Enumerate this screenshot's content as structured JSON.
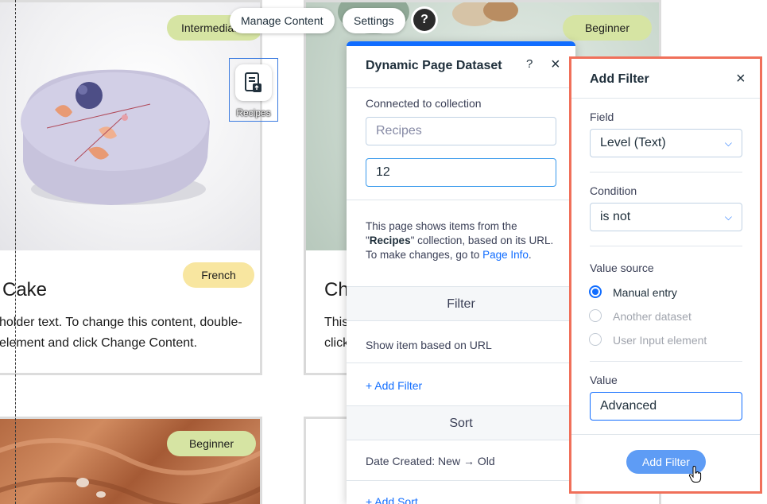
{
  "toolbar": {
    "manage_content": "Manage Content",
    "settings": "Settings",
    "help": "?"
  },
  "dataset_element": {
    "label": "Recipes",
    "icon": "dataset-icon"
  },
  "background_cards": {
    "card1": {
      "badge_top": "Intermediate",
      "badge_bottom": "French",
      "title_fragment": "Cake",
      "body_line1": "holder text. To change this content, double-",
      "body_line2": "element and click Change Content."
    },
    "card2": {
      "badge_top": "Beginner",
      "title_fragment": "Ch",
      "body_line1": "This",
      "body_line2": "click"
    },
    "card3": {
      "badge_top": "Beginner"
    }
  },
  "dataset_panel": {
    "title": "Dynamic Page Dataset",
    "help_icon": "?",
    "close_icon": "×",
    "connected_label": "Connected to collection",
    "collection_placeholder": "Recipes",
    "items_value": "12",
    "description_pre": "This page shows items from the \"",
    "description_collection": "Recipes",
    "description_mid": "\" collection, based on its URL. To make changes, go to ",
    "description_link": "Page Info",
    "description_end": ".",
    "filter_heading": "Filter",
    "filter_item": "Show item based on URL",
    "add_filter_link": "+ Add Filter",
    "sort_heading": "Sort",
    "sort_item": "Date Created: New → Old",
    "add_sort_link": "+ Add Sort"
  },
  "add_filter_panel": {
    "title": "Add Filter",
    "close_icon": "×",
    "field_label": "Field",
    "field_value": "Level (Text)",
    "condition_label": "Condition",
    "condition_value": "is not",
    "value_source_label": "Value source",
    "value_source_options": [
      {
        "label": "Manual entry",
        "selected": true
      },
      {
        "label": "Another dataset",
        "selected": false
      },
      {
        "label": "User Input element",
        "selected": false
      }
    ],
    "value_label": "Value",
    "value_input": "Advanced",
    "submit_label": "Add Filter"
  },
  "colors": {
    "accent": "#116dff",
    "highlight_frame": "#f0705a",
    "badge_green": "#d6e4a3",
    "badge_yellow": "#f8e6a0",
    "button_primary": "#5e9cf5"
  }
}
